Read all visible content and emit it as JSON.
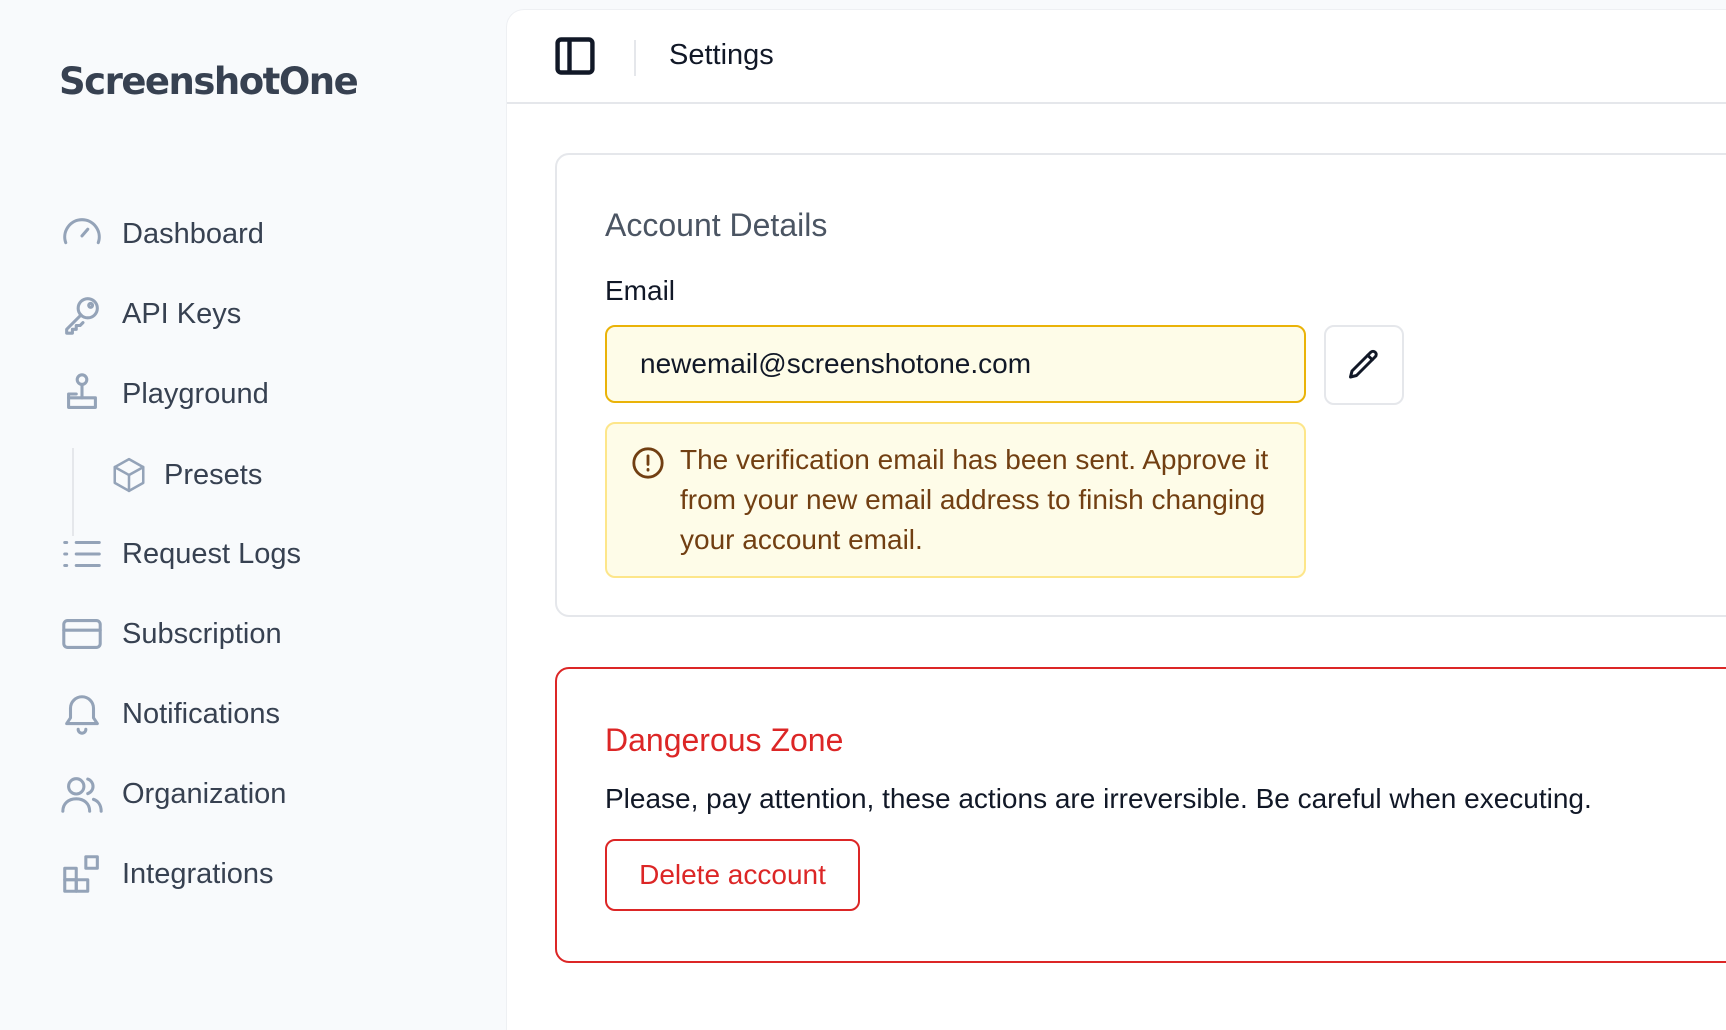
{
  "app": {
    "logo_text": "ScreenshotOne"
  },
  "sidebar": {
    "items": [
      {
        "label": "Dashboard",
        "icon": "gauge-icon"
      },
      {
        "label": "API Keys",
        "icon": "key-icon"
      },
      {
        "label": "Playground",
        "icon": "joystick-icon"
      },
      {
        "label": "Presets",
        "icon": "cube-icon"
      },
      {
        "label": "Request Logs",
        "icon": "list-icon"
      },
      {
        "label": "Subscription",
        "icon": "credit-card-icon"
      },
      {
        "label": "Notifications",
        "icon": "bell-icon"
      },
      {
        "label": "Organization",
        "icon": "users-icon"
      },
      {
        "label": "Integrations",
        "icon": "puzzle-blocks-icon"
      }
    ]
  },
  "header": {
    "title": "Settings",
    "toggle_icon": "sidebar-toggle-icon"
  },
  "account": {
    "title": "Account Details",
    "email_label": "Email",
    "email_value": "newemail@screenshotone.com",
    "edit_icon": "pencil-icon",
    "alert_icon": "alert-circle-icon",
    "alert_text": "The verification email has been sent. Approve it from your new email address to finish changing your account email."
  },
  "danger": {
    "title": "Dangerous Zone",
    "description": "Please, pay attention, these actions are irreversible. Be careful when executing.",
    "delete_label": "Delete account"
  },
  "colors": {
    "accent_warning": "#eab308",
    "warning_bg": "#fefce8",
    "danger": "#dc2626",
    "nav_icon": "#94a3b8"
  }
}
